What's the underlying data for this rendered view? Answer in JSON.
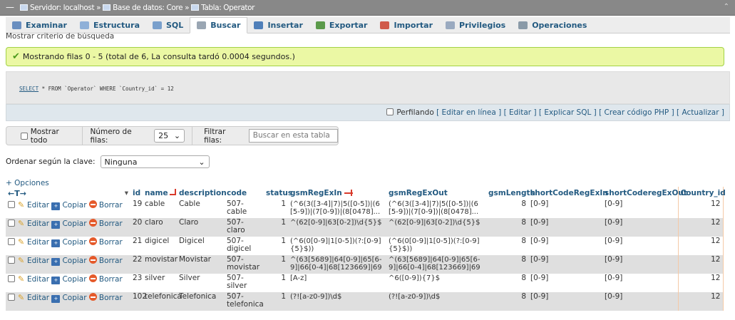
{
  "window": {
    "breadcrumb_server": "Servidor: localhost",
    "breadcrumb_db": "Base de datos: Core",
    "breadcrumb_table": "Tabla: Operator"
  },
  "tabs": [
    {
      "label": "Examinar",
      "icon": "browse-icon",
      "color": "#6a8fc0"
    },
    {
      "label": "Estructura",
      "icon": "structure-icon",
      "color": "#8fb0d8"
    },
    {
      "label": "SQL",
      "icon": "sql-icon",
      "color": "#7aa0cc"
    },
    {
      "label": "Buscar",
      "icon": "search-icon",
      "color": "#9aa6b3"
    },
    {
      "label": "Insertar",
      "icon": "insert-icon",
      "color": "#4f7fb9"
    },
    {
      "label": "Exportar",
      "icon": "export-icon",
      "color": "#5b9a4a"
    },
    {
      "label": "Importar",
      "icon": "import-icon",
      "color": "#d05a4a"
    },
    {
      "label": "Privilegios",
      "icon": "privileges-icon",
      "color": "#9aaac0"
    },
    {
      "label": "Operaciones",
      "icon": "operations-icon",
      "color": "#8a9aa8"
    }
  ],
  "active_tab": "Buscar",
  "criteria_label": "Mostrar criterio de búsqueda",
  "success_message": "Mostrando filas 0 - 5 (total de 6, La consulta tardó 0.0004 segundos.)",
  "sql": {
    "keyword": "SELECT",
    "rest": "* FROM `Operator` WHERE `Country_id` = 12"
  },
  "options_bar": {
    "profiling_label": "Perfilando",
    "links": [
      "[ Editar en línea ]",
      "[ Editar ]",
      "[ Explicar SQL ]",
      "[ Crear código PHP ]",
      "[ Actualizar ]"
    ]
  },
  "nav": {
    "show_all": "Mostrar todo",
    "rows_label": "Número de filas:",
    "rows_value": "25",
    "filter_label": "Filtrar filas:",
    "filter_placeholder": "Buscar en esta tabla"
  },
  "sort": {
    "label": "Ordenar según la clave:",
    "value": "Ninguna"
  },
  "options_link": "+ Opciones",
  "columns": [
    "id",
    "name",
    "description",
    "code",
    "status",
    "gsmRegExIn",
    "gsmRegExOut",
    "gsmLength",
    "shortCodeRegExIn",
    "shortCoderegExOut",
    "Country_id"
  ],
  "actions": {
    "edit": "Editar",
    "copy": "Copiar",
    "delete": "Borrar"
  },
  "rows": [
    {
      "id": "19",
      "name": "cable",
      "description": "Cable",
      "code": "507-cable",
      "status": "1",
      "gsmRegExIn": "(^6(3([3-4]|7)|5([0-5])|(6[5-9])|(7[0-9])|(8[0478]...",
      "gsmRegExOut": "(^6(3([3-4]|7)|5([0-5])|(6[5-9])|(7[0-9])|(8[0478]...",
      "gsmLength": "8",
      "shortCodeRegExIn": "[0-9]",
      "shortCoderegExOut": "[0-9]",
      "Country_id": "12"
    },
    {
      "id": "20",
      "name": "claro",
      "description": "Claro",
      "code": "507-claro",
      "status": "1",
      "gsmRegExIn": "^(62[0-9]|63[0-2])\\d{5}$",
      "gsmRegExOut": "^(62[0-9]|63[0-2])\\d{5}$",
      "gsmLength": "8",
      "shortCodeRegExIn": "[0-9]",
      "shortCoderegExOut": "[0-9]",
      "Country_id": "12"
    },
    {
      "id": "21",
      "name": "digicel",
      "description": "Digicel",
      "code": "507-digicel",
      "status": "1",
      "gsmRegExIn": "(^6(0[0-9]|1[0-5])(?:[0-9]{5}$))",
      "gsmRegExOut": "(^6(0[0-9]|1[0-5])(?:[0-9]{5}$))",
      "gsmLength": "8",
      "shortCodeRegExIn": "[0-9]",
      "shortCoderegExOut": "[0-9]",
      "Country_id": "12"
    },
    {
      "id": "22",
      "name": "movistar",
      "description": "Movistar",
      "code": "507-movistar",
      "status": "1",
      "gsmRegExIn": "^(63[5689]|64[0-9]|65[6-9]|66[0-4]|68[123669]|69[2...",
      "gsmRegExOut": "^(63[5689]|64[0-9]|65[6-9]|66[0-4]|68[123669]|69[2...",
      "gsmLength": "8",
      "shortCodeRegExIn": "[0-9]",
      "shortCoderegExOut": "[0-9]",
      "Country_id": "12"
    },
    {
      "id": "23",
      "name": "silver",
      "description": "Silver",
      "code": "507-silver",
      "status": "1",
      "gsmRegExIn": "[A-z]",
      "gsmRegExOut": "^6([0-9]){7}$",
      "gsmLength": "8",
      "shortCodeRegExIn": "[0-9]",
      "shortCoderegExOut": "[0-9]",
      "Country_id": "12"
    },
    {
      "id": "102",
      "name": "telefonica",
      "description": "Telefonica",
      "code": "507-telefonica",
      "status": "1",
      "gsmRegExIn": "(?![a-z0-9])\\d$",
      "gsmRegExOut": "(?![a-z0-9])\\d$",
      "gsmLength": "8",
      "shortCodeRegExIn": "[0-9]",
      "shortCoderegExOut": "[0-9]",
      "Country_id": "12"
    }
  ]
}
